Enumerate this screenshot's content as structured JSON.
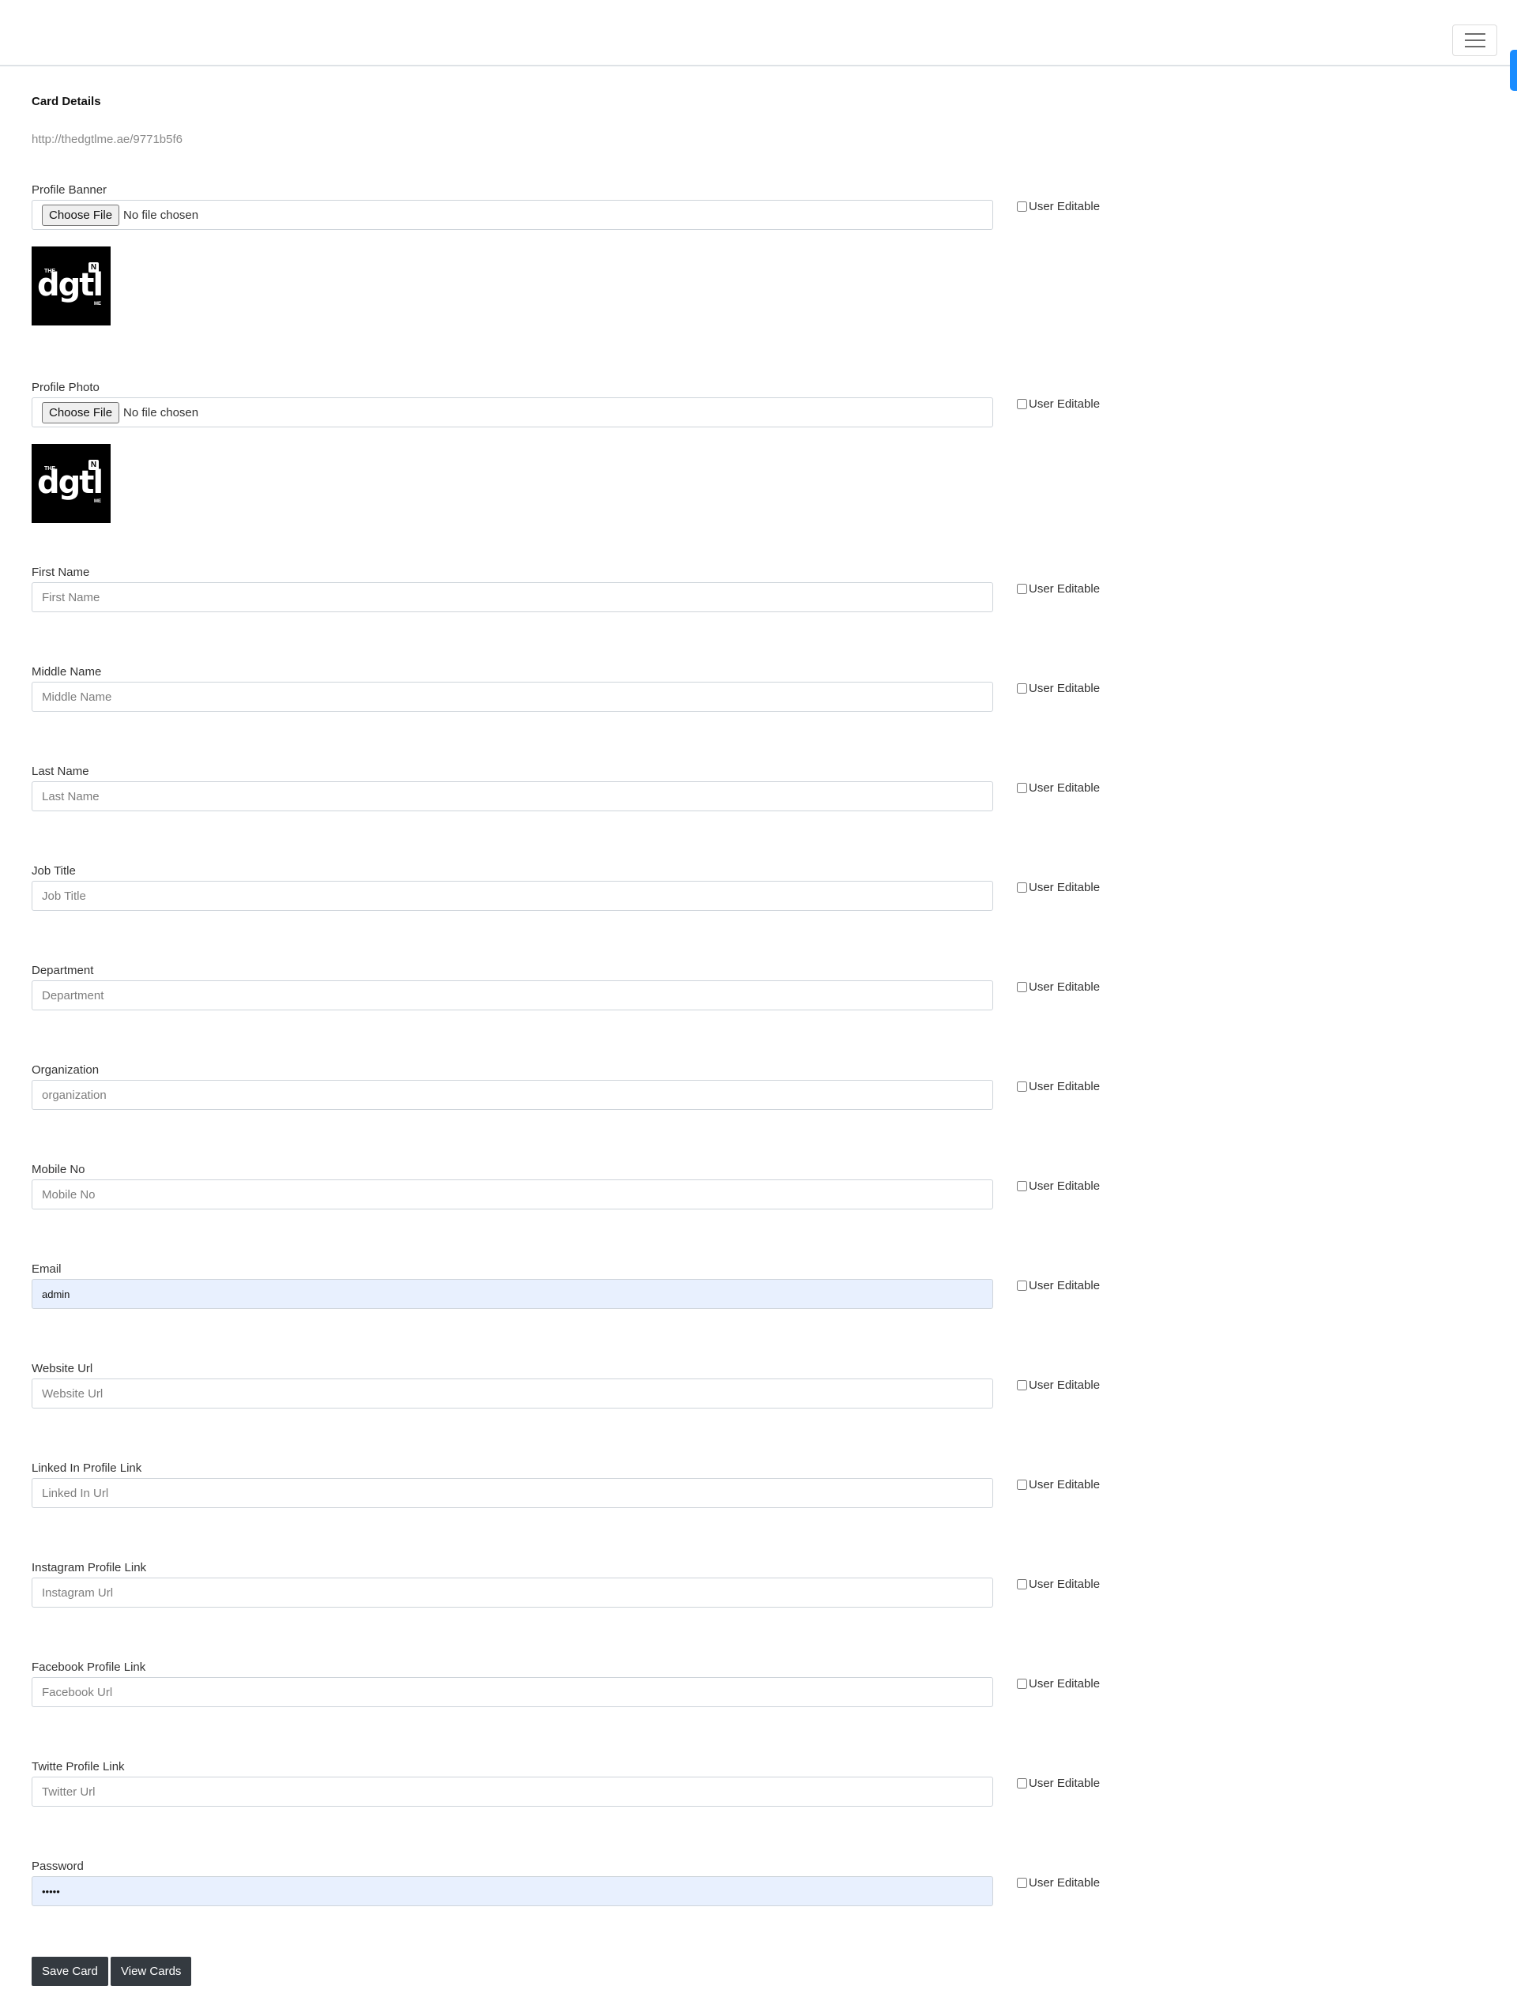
{
  "header": {
    "menu_toggle_label": ""
  },
  "card": {
    "title": "Card Details",
    "url": "http://thedgtlme.ae/9771b5f6"
  },
  "logo": {
    "the": "THE",
    "word": "dgtl",
    "me": "ME",
    "nfc": "N"
  },
  "user_editable_label": "User Editable",
  "file_fields": [
    {
      "label": "Profile Banner",
      "button": "Choose File",
      "status": "No file chosen"
    },
    {
      "label": "Profile Photo",
      "button": "Choose File",
      "status": "No file chosen"
    }
  ],
  "fields": [
    {
      "label": "First Name",
      "placeholder": "First Name",
      "value": ""
    },
    {
      "label": "Middle Name",
      "placeholder": "Middle Name",
      "value": ""
    },
    {
      "label": "Last Name",
      "placeholder": "Last Name",
      "value": ""
    },
    {
      "label": "Job Title",
      "placeholder": "Job Title",
      "value": ""
    },
    {
      "label": "Department",
      "placeholder": "Department",
      "value": ""
    },
    {
      "label": "Organization",
      "placeholder": "organization",
      "value": ""
    },
    {
      "label": "Mobile No",
      "placeholder": "Mobile No",
      "value": ""
    },
    {
      "label": "Email",
      "placeholder": "",
      "value": "admin"
    },
    {
      "label": "Website Url",
      "placeholder": "Website Url",
      "value": ""
    },
    {
      "label": "Linked In Profile Link",
      "placeholder": "Linked In Url",
      "value": ""
    },
    {
      "label": "Instagram Profile Link",
      "placeholder": "Instagram Url",
      "value": ""
    },
    {
      "label": "Facebook Profile Link",
      "placeholder": "Facebook Url",
      "value": ""
    },
    {
      "label": "Twitte Profile Link",
      "placeholder": "Twitter Url",
      "value": ""
    },
    {
      "label": "Password",
      "placeholder": "",
      "value": "•••••"
    }
  ],
  "actions": {
    "save_label": "Save Card",
    "view_label": "View Cards"
  },
  "colors": {
    "button_dark": "#343a40",
    "autofill_bg": "#e8f0fe",
    "scroll_indicator": "#1a8cff"
  }
}
